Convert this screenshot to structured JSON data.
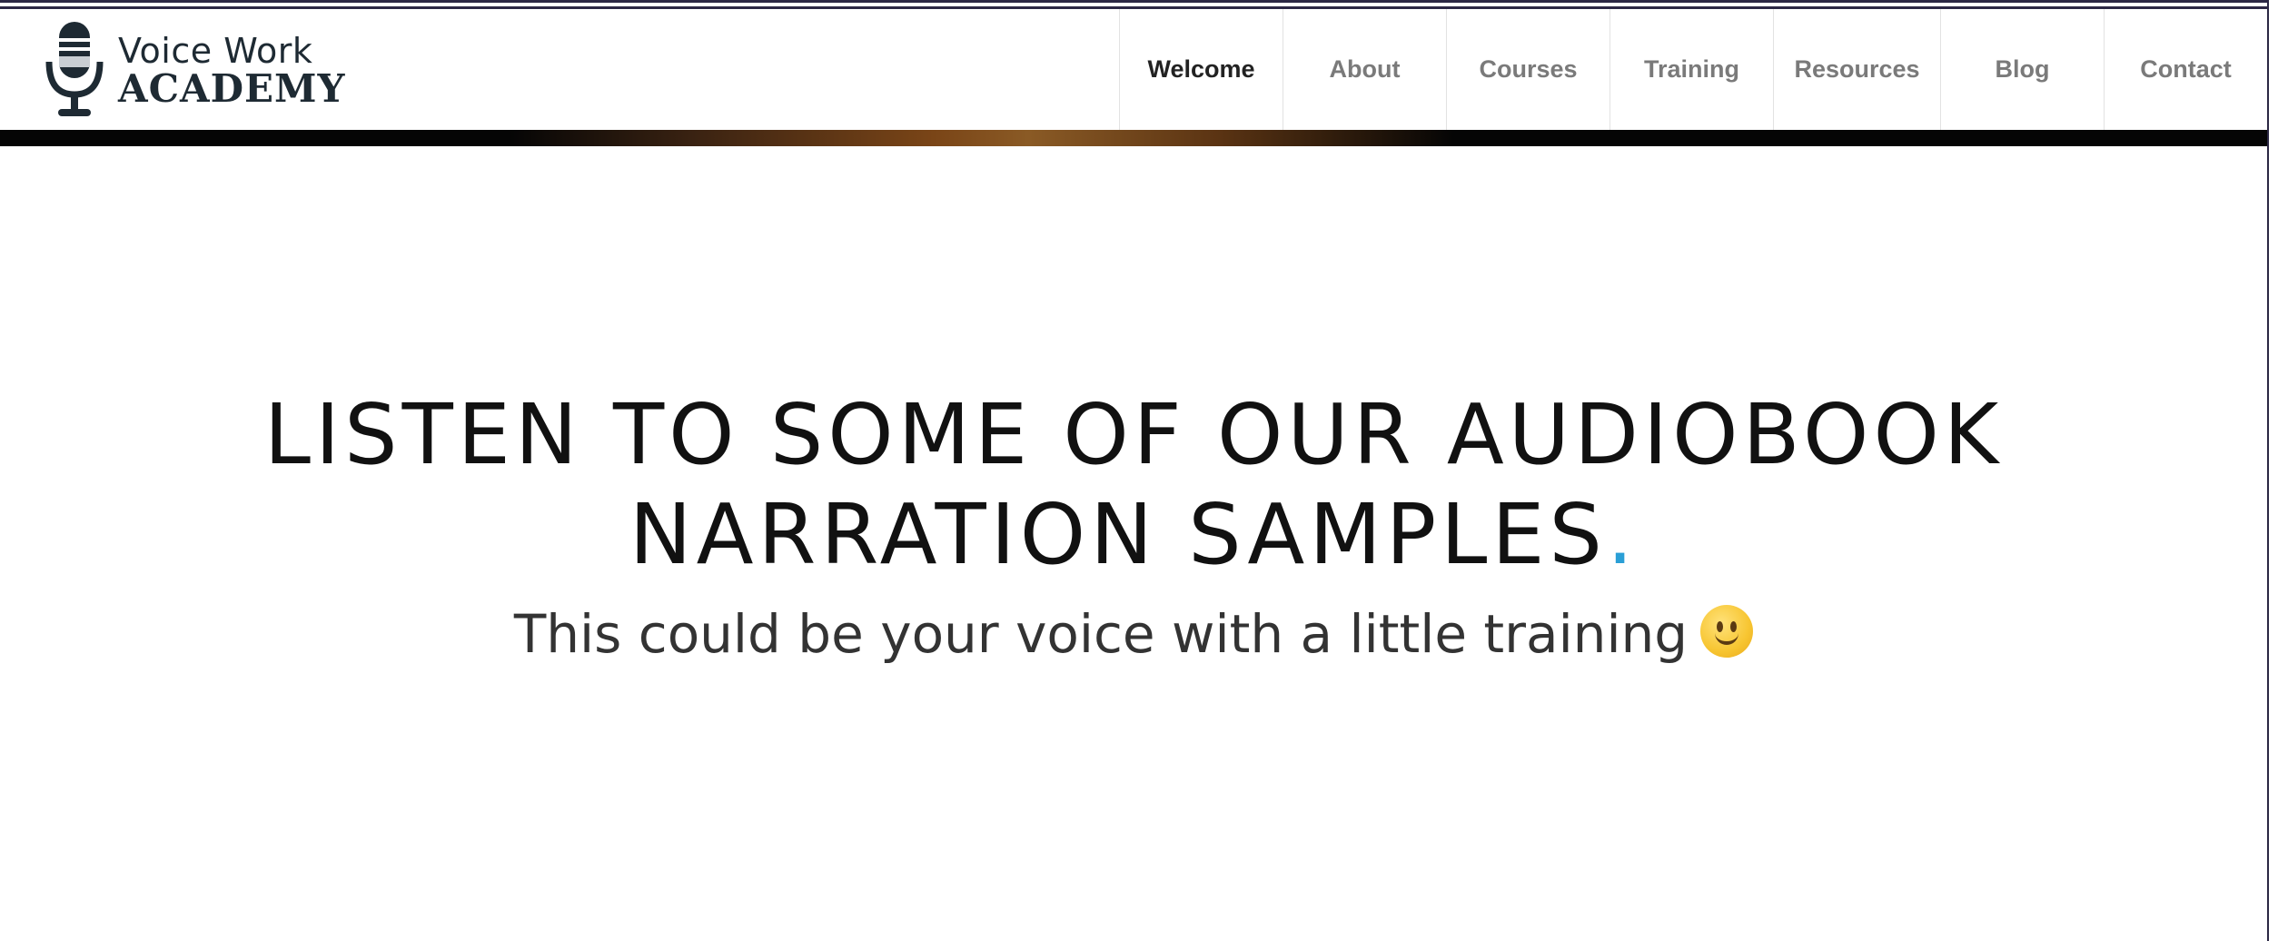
{
  "logo": {
    "line1": "Voice Work",
    "line2": "ACADEMY",
    "icon": "microphone-icon"
  },
  "nav": {
    "items": [
      {
        "label": "Welcome",
        "active": true
      },
      {
        "label": "About",
        "active": false
      },
      {
        "label": "Courses",
        "active": false
      },
      {
        "label": "Training",
        "active": false
      },
      {
        "label": "Resources",
        "active": false
      },
      {
        "label": "Blog",
        "active": false
      },
      {
        "label": "Contact",
        "active": false
      }
    ]
  },
  "main": {
    "headline_line1": "LISTEN TO SOME OF OUR AUDIOBOOK",
    "headline_line2": "NARRATION SAMPLES",
    "headline_dot": ".",
    "subtitle": "This could be your voice with a little training",
    "emoji": "smiley-face-icon"
  },
  "colors": {
    "accent": "#2a9fd6",
    "logo": "#1e2a33",
    "nav_active": "#222222",
    "nav_inactive": "#7a7a7a"
  }
}
